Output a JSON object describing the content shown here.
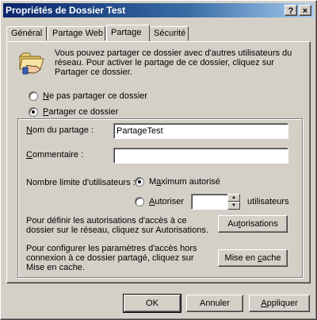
{
  "window": {
    "title": "Propriétés de Dossier Test",
    "help_button": "?",
    "close_button": "×"
  },
  "tabs": [
    {
      "label": "Général",
      "active": false
    },
    {
      "label": "Partage Web",
      "active": false
    },
    {
      "label": "Partage",
      "active": true
    },
    {
      "label": "Sécurité",
      "active": false
    }
  ],
  "sharing": {
    "info_text": "Vous pouvez partager ce dossier avec d'autres utilisateurs du réseau. Pour activer le partage de ce dossier, cliquez sur Partager ce dossier.",
    "no_share_option": {
      "label_access": "N",
      "label_rest": "e pas partager ce dossier",
      "selected": false
    },
    "share_option": {
      "label_access": "P",
      "label_rest": "artager ce dossier",
      "selected": true
    },
    "share_name_label_access": "N",
    "share_name_label_rest": "om du partage :",
    "share_name_value": "PartageTest",
    "comment_label_access": "C",
    "comment_label_rest": "ommentaire :",
    "comment_value": "",
    "user_limit_label": "Nombre limite d'utilisateurs :",
    "max_allowed": {
      "label_pre": "M",
      "label_access": "a",
      "label_rest": "ximum autorisé",
      "selected": true
    },
    "allow": {
      "label_access": "A",
      "label_rest": "utoriser",
      "selected": false
    },
    "users_value": "",
    "users_suffix": "utilisateurs",
    "permissions_text": "Pour définir les autorisations d'accès à ce dossier sur le réseau, cliquez sur Autorisations.",
    "permissions_button_pre": "Au",
    "permissions_button_access": "t",
    "permissions_button_rest": "orisations",
    "caching_text": "Pour configurer les paramètres d'accès hors connexion à ce dossier partagé, cliquez sur Mise en cache.",
    "caching_button_pre": "Mise en ",
    "caching_button_access": "c",
    "caching_button_rest": "ache"
  },
  "footer": {
    "ok": "OK",
    "cancel": "Annuler",
    "apply_access": "A",
    "apply_rest": "ppliquer"
  }
}
